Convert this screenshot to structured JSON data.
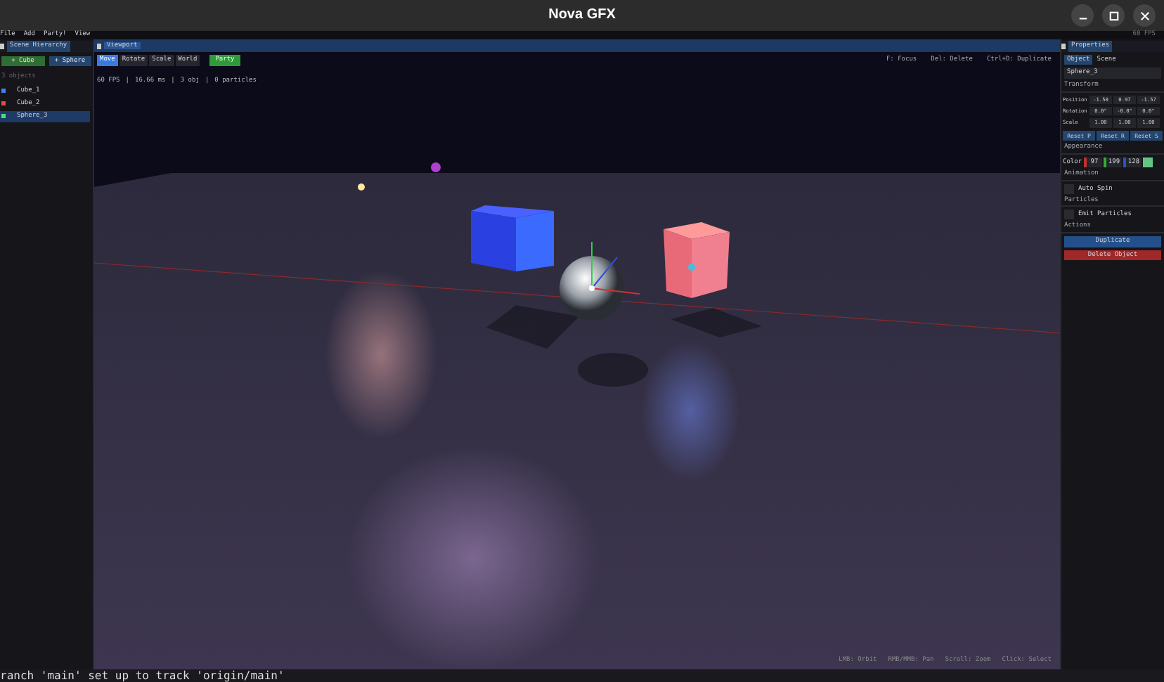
{
  "window": {
    "title": "Nova GFX"
  },
  "menu": [
    "File",
    "Add",
    "Party!",
    "View"
  ],
  "scene_hierarchy": {
    "tab": "Scene Hierarchy",
    "buttons": [
      "+ Cube",
      "+ Sphere"
    ],
    "count": "3 objects",
    "items": [
      {
        "name": "Cube_1",
        "color": "#3b82f6",
        "selected": false
      },
      {
        "name": "Cube_2",
        "color": "#ef4444",
        "selected": false
      },
      {
        "name": "Sphere_3",
        "color": "#4ade80",
        "selected": true
      }
    ]
  },
  "viewport": {
    "tab": "Viewport",
    "modes": [
      {
        "label": "Move",
        "selected": true
      },
      {
        "label": "Rotate",
        "selected": false
      },
      {
        "label": "Scale",
        "selected": false
      },
      {
        "label": "World",
        "selected": false
      }
    ],
    "party_button": "Party",
    "stats": [
      "60 FPS",
      "|",
      "16.66 ms",
      "|",
      "3 obj",
      "|",
      "0 particles"
    ],
    "shortcuts": [
      "F: Focus",
      "Del: Delete",
      "Ctrl+D: Duplicate"
    ],
    "hints": [
      "LMB: Orbit",
      "RMB/MMB: Pan",
      "Scroll: Zoom",
      "Click: Select"
    ]
  },
  "fps": "60 FPS",
  "properties": {
    "tab": "Properties",
    "tabs": [
      {
        "label": "Object",
        "selected": true
      },
      {
        "label": "Scene",
        "selected": false
      }
    ],
    "name": "Sphere_3",
    "transform_title": "Transform",
    "transform": [
      {
        "label": "Position",
        "values": [
          "-1.50",
          "0.97",
          "-1.57"
        ]
      },
      {
        "label": "Rotation",
        "values": [
          "0.0°",
          "-0.0°",
          "0.0°"
        ]
      },
      {
        "label": "Scale",
        "values": [
          "1.00",
          "1.00",
          "1.00"
        ]
      }
    ],
    "resets": [
      "Reset P",
      "Reset R",
      "Reset S"
    ],
    "appearance_title": "Appearance",
    "color_label": "Color",
    "color_values": [
      "97",
      "199",
      "128"
    ],
    "color": "#61c780",
    "animation_title": "Animation",
    "auto_spin": {
      "label": "Auto Spin",
      "checked": false
    },
    "particles_title": "Particles",
    "emit_particles": {
      "label": "Emit Particles",
      "checked": false
    },
    "actions_title": "Actions",
    "actions": [
      {
        "label": "Duplicate",
        "kind": "primary"
      },
      {
        "label": "Delete Object",
        "kind": "danger"
      }
    ]
  },
  "terminal": "ranch 'main' set up to track 'origin/main'"
}
